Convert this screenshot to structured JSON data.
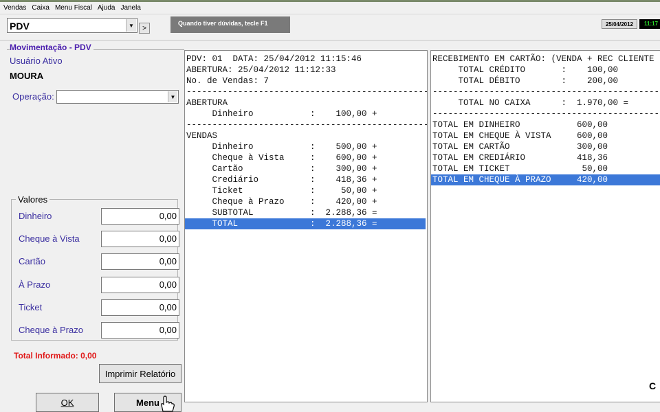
{
  "menu": [
    "Vendas",
    "Caixa",
    "Menu Fiscal",
    "Ajuda",
    "Janela"
  ],
  "toolbar": {
    "selector_value": "PDV",
    "next_label": ">",
    "hint": "Quando tiver dúvidas, tecle  F1",
    "date": "25/04/2012",
    "clock": "11:17"
  },
  "left": {
    "title": "Movimentação - PDV",
    "user_label": "Usuário Ativo",
    "user_name": "MOURA",
    "operation_label": "Operação:",
    "operation_value": "",
    "values_title": "Valores",
    "values": [
      {
        "label": "Dinheiro",
        "value": "0,00"
      },
      {
        "label": "Cheque à Vista",
        "value": "0,00"
      },
      {
        "label": "Cartão",
        "value": "0,00"
      },
      {
        "label": "À Prazo",
        "value": "0,00"
      },
      {
        "label": "Ticket",
        "value": "0,00"
      },
      {
        "label": "Cheque à Prazo",
        "value": "0,00"
      }
    ],
    "total_informado": "Total Informado: 0,00",
    "print_button": "Imprimir Relatório",
    "ok_button": "OK",
    "menu_button": "Menu"
  },
  "report_left": [
    {
      "text": "PDV: 01  DATA: 25/04/2012 11:15:46",
      "hl": false
    },
    {
      "text": "ABERTURA: 25/04/2012 11:12:33",
      "hl": false
    },
    {
      "text": "No. de Vendas: 7",
      "hl": false
    },
    {
      "text": "------------------------------------------------",
      "hl": false
    },
    {
      "text": "ABERTURA",
      "hl": false
    },
    {
      "text": "     Dinheiro           :    100,00 +",
      "hl": false
    },
    {
      "text": "------------------------------------------------",
      "hl": false
    },
    {
      "text": "VENDAS",
      "hl": false
    },
    {
      "text": "     Dinheiro           :    500,00 +",
      "hl": false
    },
    {
      "text": "     Cheque à Vista     :    600,00 +",
      "hl": false
    },
    {
      "text": "     Cartão             :    300,00 +",
      "hl": false
    },
    {
      "text": "     Crediário          :    418,36 +",
      "hl": false
    },
    {
      "text": "     Ticket             :     50,00 +",
      "hl": false
    },
    {
      "text": "     Cheque à Prazo     :    420,00 +",
      "hl": false
    },
    {
      "text": "     SUBTOTAL           :  2.288,36 =",
      "hl": false
    },
    {
      "text": "     TOTAL              :  2.288,36 =",
      "hl": true
    }
  ],
  "report_right": [
    {
      "text": "RECEBIMENTO EM CARTÃO: (VENDA + REC CLIENTE",
      "hl": false
    },
    {
      "text": "     TOTAL CRÉDITO       :    100,00",
      "hl": false
    },
    {
      "text": "     TOTAL DÉBITO        :    200,00",
      "hl": false
    },
    {
      "text": "------------------------------------------------",
      "hl": false
    },
    {
      "text": "     TOTAL NO CAIXA      :  1.970,00 =",
      "hl": false
    },
    {
      "text": "------------------------------------------------",
      "hl": false
    },
    {
      "text": "TOTAL EM DINHEIRO           600,00",
      "hl": false
    },
    {
      "text": "TOTAL EM CHEQUE À VISTA     600,00",
      "hl": false
    },
    {
      "text": "TOTAL EM CARTÃO             300,00",
      "hl": false
    },
    {
      "text": "TOTAL EM CREDIÁRIO          418,36",
      "hl": false
    },
    {
      "text": "TOTAL EM TICKET              50,00",
      "hl": false
    },
    {
      "text": "TOTAL EM CHEQUE À PRAZO     420,00",
      "hl": true
    }
  ],
  "edge_char": "C"
}
